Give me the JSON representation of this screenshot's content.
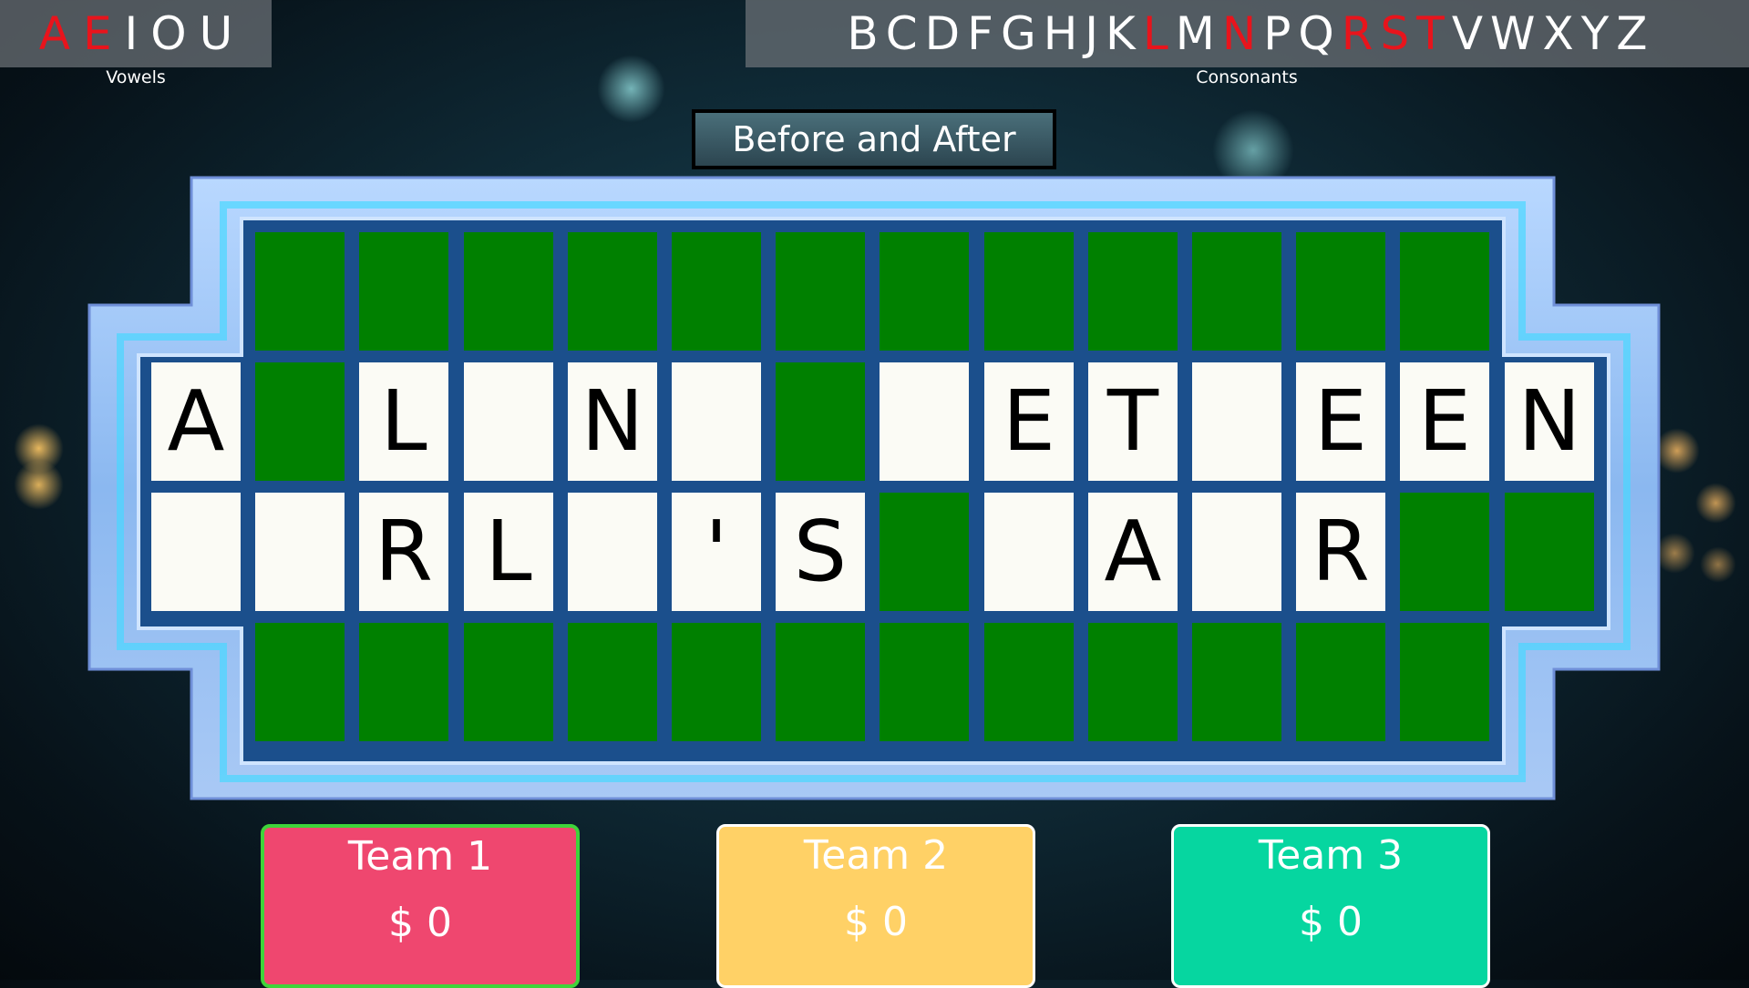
{
  "vowels": {
    "label": "Vowels",
    "letters": [
      {
        "letter": "A",
        "used": true
      },
      {
        "letter": "E",
        "used": true
      },
      {
        "letter": "I",
        "used": false
      },
      {
        "letter": "O",
        "used": false
      },
      {
        "letter": "U",
        "used": false
      }
    ]
  },
  "consonants": {
    "label": "Consonants",
    "letters": [
      {
        "letter": "B",
        "used": false
      },
      {
        "letter": "C",
        "used": false
      },
      {
        "letter": "D",
        "used": false
      },
      {
        "letter": "F",
        "used": false
      },
      {
        "letter": "G",
        "used": false
      },
      {
        "letter": "H",
        "used": false
      },
      {
        "letter": "J",
        "used": false
      },
      {
        "letter": "K",
        "used": false
      },
      {
        "letter": "L",
        "used": true
      },
      {
        "letter": "M",
        "used": false
      },
      {
        "letter": "N",
        "used": true
      },
      {
        "letter": "P",
        "used": false
      },
      {
        "letter": "Q",
        "used": false
      },
      {
        "letter": "R",
        "used": true
      },
      {
        "letter": "S",
        "used": true
      },
      {
        "letter": "T",
        "used": true
      },
      {
        "letter": "V",
        "used": false
      },
      {
        "letter": "W",
        "used": false
      },
      {
        "letter": "X",
        "used": false
      },
      {
        "letter": "Y",
        "used": false
      },
      {
        "letter": "Z",
        "used": false
      }
    ]
  },
  "category": "Before and After",
  "board": {
    "rows": [
      [
        "#",
        "#",
        "#",
        "#",
        "#",
        "#",
        "#",
        "#",
        "#",
        "#",
        "#",
        "#"
      ],
      [
        "A",
        "#",
        "L",
        "",
        "N",
        "",
        "#",
        "",
        "E",
        "T",
        "",
        "E",
        "E",
        "N"
      ],
      [
        "",
        "",
        "R",
        "L",
        "",
        "'",
        "S",
        "#",
        "",
        "A",
        "",
        "R",
        "#",
        "#"
      ],
      [
        "#",
        "#",
        "#",
        "#",
        "#",
        "#",
        "#",
        "#",
        "#",
        "#",
        "#",
        "#"
      ]
    ]
  },
  "teams": [
    {
      "name": "Team 1",
      "score": "$ 0",
      "color": "#ef476f",
      "border": "#3fd43a",
      "active": true
    },
    {
      "name": "Team 2",
      "score": "$ 0",
      "color": "#ffd166",
      "border": "#ffffff",
      "active": false
    },
    {
      "name": "Team 3",
      "score": "$ 0",
      "color": "#06d6a0",
      "border": "#ffffff",
      "active": false
    }
  ],
  "colors": {
    "used_letter": "#e8141c",
    "tile_green": "#008000",
    "tile_white": "#fbfbf5"
  }
}
